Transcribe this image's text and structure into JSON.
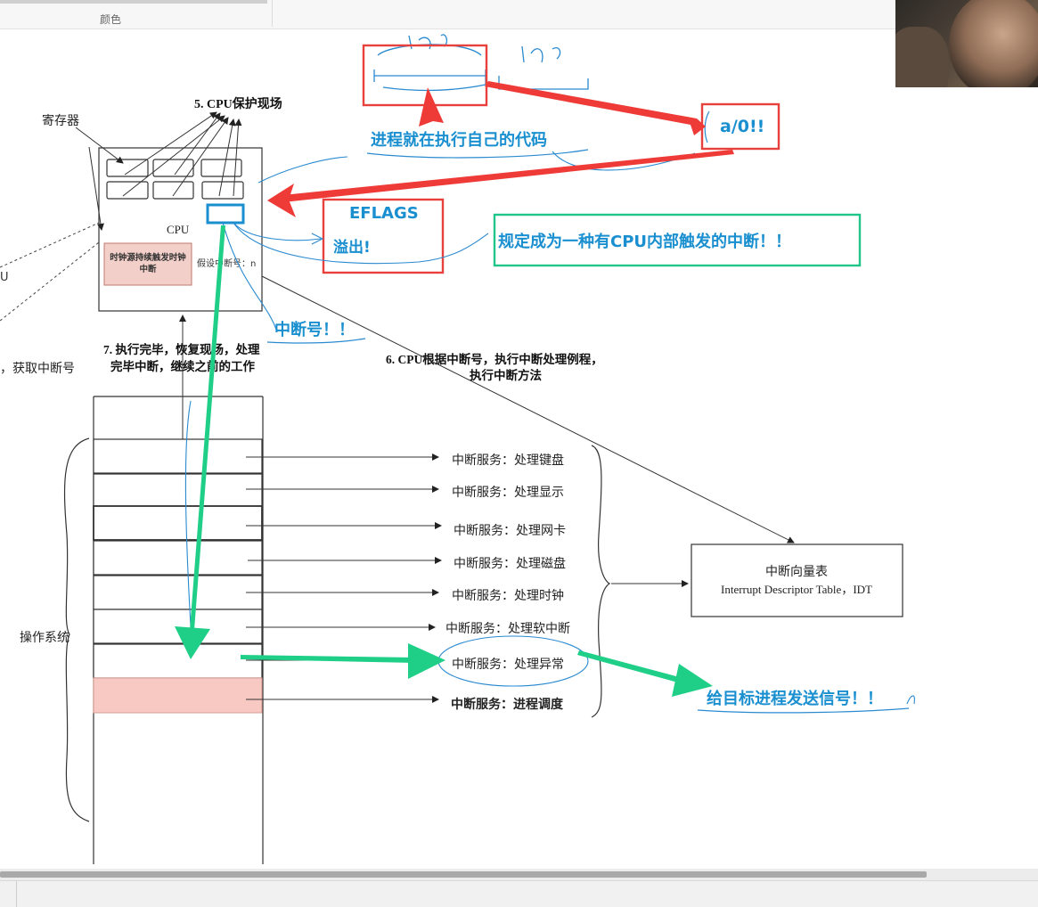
{
  "ribbon": {
    "group_label": "颜色"
  },
  "diagram": {
    "registers_label": "寄存器",
    "step5_label": "5. CPU保护现场",
    "cpu_label": "CPU",
    "clock_box_text_line1": "时钟源持续触发时钟",
    "clock_box_text_line2": "中断",
    "assume_irq_text": "假设中断号：n",
    "left_cut_text": "U",
    "left_get_irq_text": "，获取中断号",
    "step7_line1": "7. 执行完毕，恢复现场，处理",
    "step7_line2": "完毕中断，继续之前的工作",
    "step6_line1": "6. CPU根据中断号，执行中断处理例程，",
    "step6_line2": "执行中断方法",
    "os_label": "操作系统",
    "services": [
      "中断服务：处理键盘",
      "中断服务：处理显示",
      "中断服务：处理网卡",
      "中断服务：处理磁盘",
      "中断服务：处理时钟",
      "中断服务：处理软中断",
      "中断服务：处理异常",
      "中断服务：进程调度"
    ],
    "idt_title": "中断向量表",
    "idt_subtitle": "Interrupt Descriptor Table，IDT"
  },
  "annotations": {
    "process_running": "进程就在执行自己的代码",
    "div_zero": "a/0!!",
    "eflags": "EFLAGS",
    "overflow": "溢出!",
    "cpu_internal_interrupt": "规定成为一种有CPU内部触发的中断！！",
    "irq_number": "中断号！！",
    "send_signal": "给目标进程发送信号！！"
  },
  "colors": {
    "annotation_blue": "#1a8fd0",
    "red_box": "#e8413d",
    "green_box": "#20c58a",
    "green_arrow": "#1fcf88",
    "red_arrow": "#ef3b37",
    "scheduler_fill": "#f7c9c2",
    "clock_fill": "#f2cfc9"
  }
}
